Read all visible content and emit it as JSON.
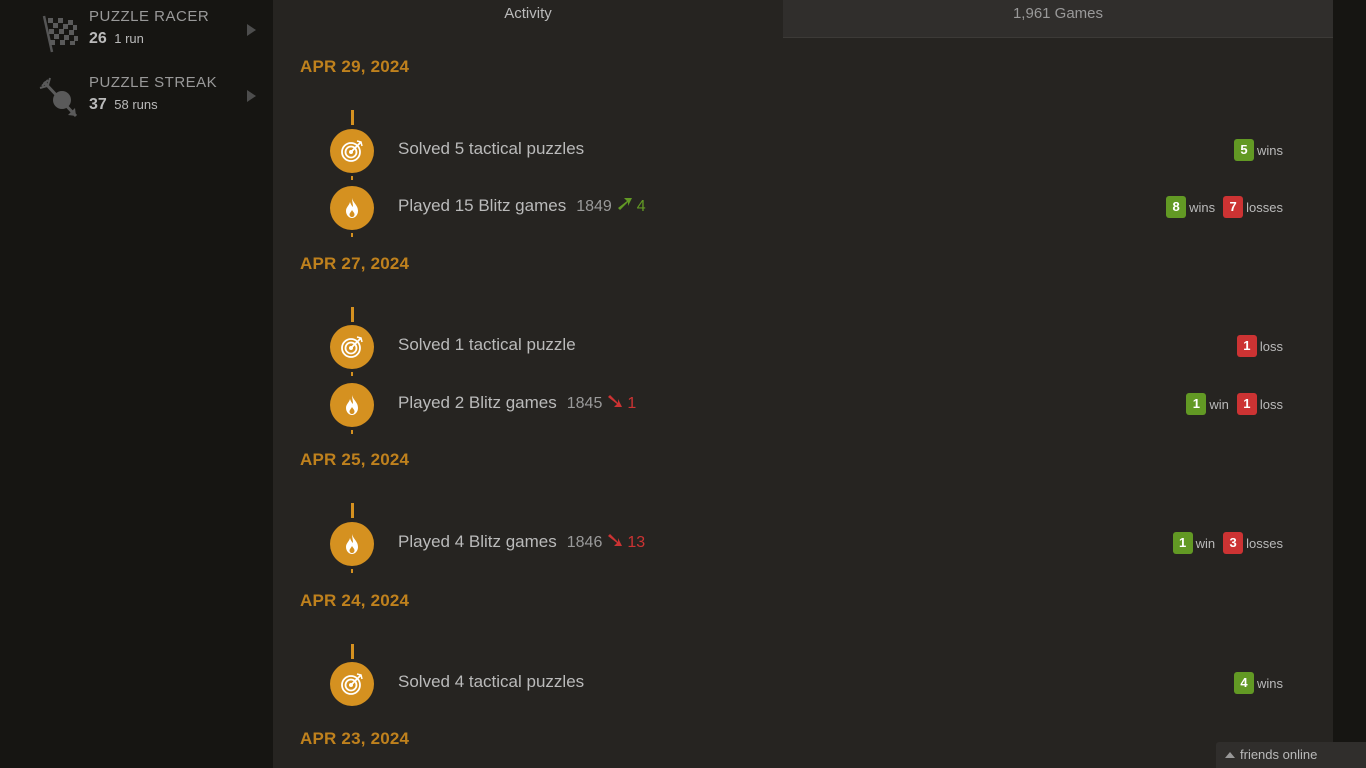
{
  "sidebar": {
    "puzzle_racer": {
      "title": "PUZZLE RACER",
      "score": "26",
      "sub": "1 run"
    },
    "puzzle_streak": {
      "title": "PUZZLE STREAK",
      "score": "37",
      "sub": "58 runs"
    }
  },
  "tabs": {
    "activity": "Activity",
    "games": "1,961 Games"
  },
  "days": [
    {
      "date": "APR 29, 2024",
      "entries": [
        {
          "icon": "target-icon",
          "text": "Solved 5 tactical puzzles",
          "results": {
            "wins": "5",
            "wins_label": "wins"
          }
        },
        {
          "icon": "fire-icon",
          "text": "Played 15 Blitz games",
          "rating": "1849",
          "trend": "up",
          "diff": "4",
          "results": {
            "wins": "8",
            "wins_label": "wins",
            "losses": "7",
            "losses_label": "losses"
          }
        }
      ]
    },
    {
      "date": "APR 27, 2024",
      "entries": [
        {
          "icon": "target-icon",
          "text": "Solved 1 tactical puzzle",
          "results": {
            "losses": "1",
            "losses_label": "loss"
          }
        },
        {
          "icon": "fire-icon",
          "text": "Played 2 Blitz games",
          "rating": "1845",
          "trend": "down",
          "diff": "1",
          "results": {
            "wins": "1",
            "wins_label": "win",
            "losses": "1",
            "losses_label": "loss"
          }
        }
      ]
    },
    {
      "date": "APR 25, 2024",
      "entries": [
        {
          "icon": "fire-icon",
          "text": "Played 4 Blitz games",
          "rating": "1846",
          "trend": "down",
          "diff": "13",
          "results": {
            "wins": "1",
            "wins_label": "win",
            "losses": "3",
            "losses_label": "losses"
          }
        }
      ]
    },
    {
      "date": "APR 24, 2024",
      "entries": [
        {
          "icon": "target-icon",
          "text": "Solved 4 tactical puzzles",
          "results": {
            "wins": "4",
            "wins_label": "wins"
          }
        }
      ]
    },
    {
      "date": "APR 23, 2024",
      "entries": []
    }
  ],
  "friends": {
    "label": "friends online"
  },
  "colors": {
    "accent": "#d59120",
    "win": "#629924",
    "loss": "#cc3333",
    "date": "#bf811d"
  }
}
